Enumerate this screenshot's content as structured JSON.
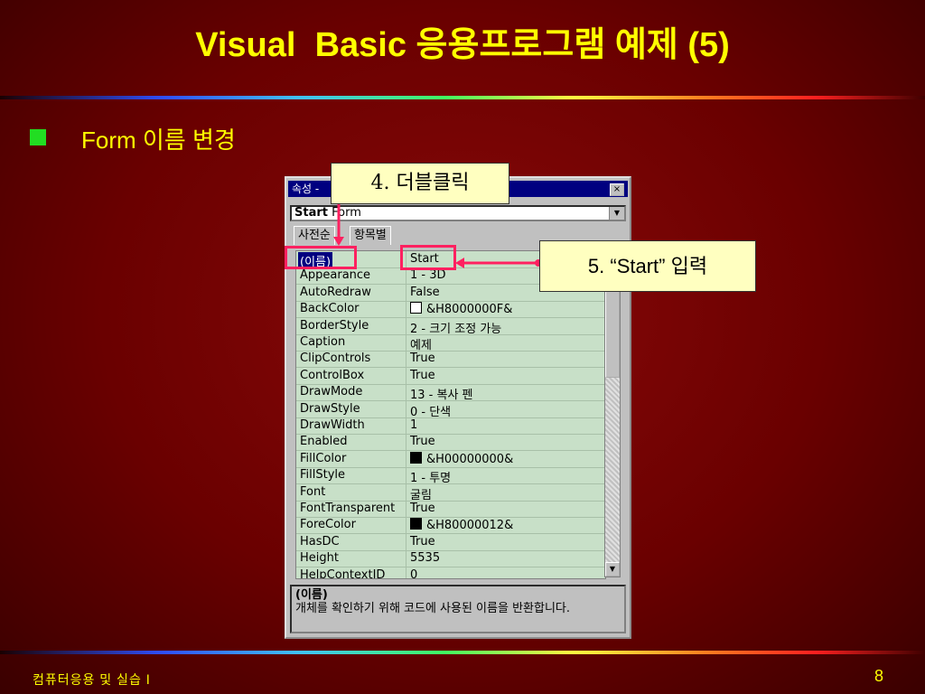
{
  "slide": {
    "title": "Visual  Basic 응용프로그램 예제 (5)",
    "bullet": "Form 이름 변경",
    "footer_left": "컴퓨터응용 및 실습 Ⅰ",
    "page_number": "8"
  },
  "window": {
    "title": "속성 -",
    "close_label": "×",
    "object_combo_bold": "Start",
    "object_combo_rest": " Form",
    "tabs": [
      "사전순",
      "항목별"
    ],
    "properties": [
      {
        "name": "(이름)",
        "value": "Start",
        "selected": true
      },
      {
        "name": "Appearance",
        "value": "1 - 3D"
      },
      {
        "name": "AutoRedraw",
        "value": "False"
      },
      {
        "name": "BackColor",
        "value": "&H8000000F&",
        "swatch": "white"
      },
      {
        "name": "BorderStyle",
        "value": "2 - 크기 조정 가능"
      },
      {
        "name": "Caption",
        "value": "예제"
      },
      {
        "name": "ClipControls",
        "value": "True"
      },
      {
        "name": "ControlBox",
        "value": "True"
      },
      {
        "name": "DrawMode",
        "value": "13 - 복사 펜"
      },
      {
        "name": "DrawStyle",
        "value": "0 - 단색"
      },
      {
        "name": "DrawWidth",
        "value": "1"
      },
      {
        "name": "Enabled",
        "value": "True"
      },
      {
        "name": "FillColor",
        "value": "&H00000000&",
        "swatch": "black"
      },
      {
        "name": "FillStyle",
        "value": "1 - 투명"
      },
      {
        "name": "Font",
        "value": "굴림"
      },
      {
        "name": "FontTransparent",
        "value": "True"
      },
      {
        "name": "ForeColor",
        "value": "&H80000012&",
        "swatch": "black"
      },
      {
        "name": "HasDC",
        "value": "True"
      },
      {
        "name": "Height",
        "value": "5535"
      },
      {
        "name": "HelpContextID",
        "value": "0"
      }
    ],
    "description_heading": "(이름)",
    "description_text": "개체를 확인하기 위해 코드에 사용된 이름을 반환합니다."
  },
  "callouts": {
    "double_click": "4. 더블클릭",
    "enter_start": "5. “Start” 입력"
  },
  "colors": {
    "title_text": "#ffff00",
    "bullet": "#22dd22",
    "callout_bg": "#ffffc0",
    "highlight": "#ff2060",
    "grid_bg": "#c8e0c8",
    "selection": "#000080"
  }
}
